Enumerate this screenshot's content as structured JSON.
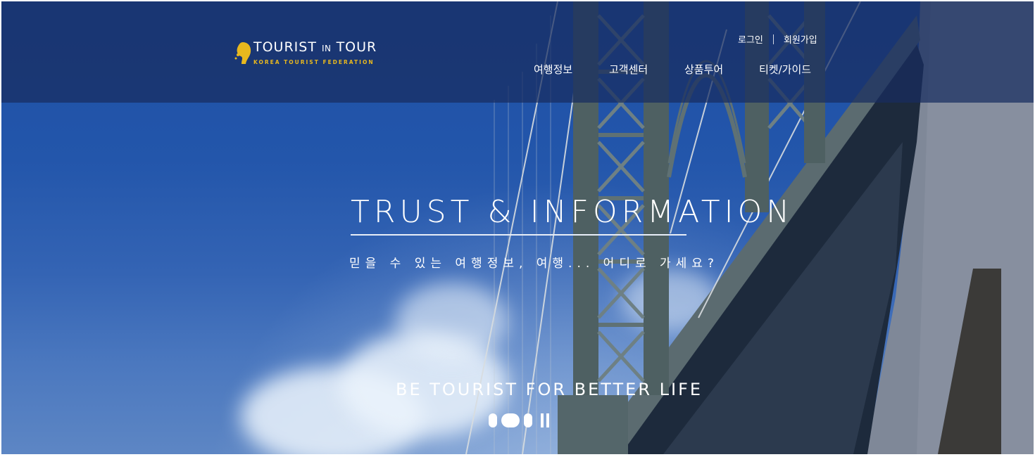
{
  "header": {
    "logo": {
      "title_main": "TOURIST",
      "title_in": "IN",
      "title_tail": "TOUR",
      "subtitle": "KOREA TOURIST FEDERATION",
      "accent_color": "#e8b81e"
    },
    "util_links": {
      "login": "로그인",
      "join": "회원가입"
    },
    "nav": [
      {
        "label": "여행정보"
      },
      {
        "label": "고객센터"
      },
      {
        "label": "상품투어"
      },
      {
        "label": "티켓/가이드"
      }
    ]
  },
  "hero": {
    "title": "TRUST & INFORMATION",
    "subtitle": "믿을 수 있는 여행정보, 여행... 어디로 가세요?",
    "tagline": "BE TOURIST FOR BETTER LIFE",
    "background": "bridge-and-sky-photo"
  },
  "slider": {
    "slide_count": 3,
    "active_slide": 2,
    "pause_icon": "pause-icon"
  }
}
